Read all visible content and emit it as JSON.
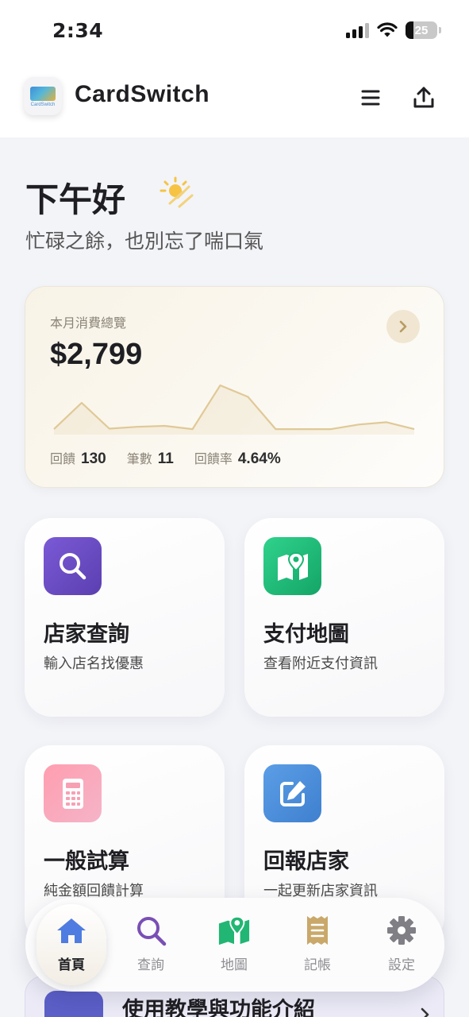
{
  "status_bar": {
    "time": "2:34",
    "battery": "25",
    "battery_level": 0.25
  },
  "header": {
    "app_name": "CardSwitch",
    "logo_text": "CardSwitch",
    "menu_icon": "hamburger-menu-icon",
    "share_icon": "share-upload-icon"
  },
  "greeting": {
    "title": "下午好",
    "icon": "sun-haze-icon",
    "subtitle": "忙碌之餘，也別忘了喘口氣"
  },
  "summary": {
    "label": "本月消費總覽",
    "amount": "$2,799",
    "stats": [
      {
        "label": "回饋",
        "value": "130"
      },
      {
        "label": "筆數",
        "value": "11"
      },
      {
        "label": "回饋率",
        "value": "4.64%"
      }
    ],
    "trend": [
      0.05,
      0.62,
      0.06,
      0.1,
      0.12,
      0.05,
      1.0,
      0.75,
      0.05,
      0.05,
      0.05,
      0.15,
      0.2,
      0.05
    ],
    "accent_color": "#e0c997"
  },
  "tiles": [
    {
      "title": "店家查詢",
      "desc": "輸入店名找優惠",
      "icon": "search-icon",
      "color": "#6a4fc0"
    },
    {
      "title": "支付地圖",
      "desc": "查看附近支付資訊",
      "icon": "map-pin-icon",
      "color": "#1fbe7a"
    },
    {
      "title": "一般試算",
      "desc": "純金額回饋計算",
      "icon": "calculator-icon",
      "color": "#f7a0b3"
    },
    {
      "title": "回報店家",
      "desc": "一起更新店家資訊",
      "icon": "edit-icon",
      "color": "#4a8fd8"
    }
  ],
  "tutorial": {
    "title": "使用教學與功能介紹"
  },
  "nav": {
    "items": [
      {
        "label": "首頁",
        "icon": "home-icon",
        "active": true,
        "color": "#4f7ce0"
      },
      {
        "label": "查詢",
        "icon": "search-icon",
        "active": false,
        "color": "#7a4fb5"
      },
      {
        "label": "地圖",
        "icon": "map-icon",
        "active": false,
        "color": "#21b673"
      },
      {
        "label": "記帳",
        "icon": "receipt-icon",
        "active": false,
        "color": "#c9a86a"
      },
      {
        "label": "設定",
        "icon": "gear-icon",
        "active": false,
        "color": "#7f7f85"
      }
    ]
  }
}
